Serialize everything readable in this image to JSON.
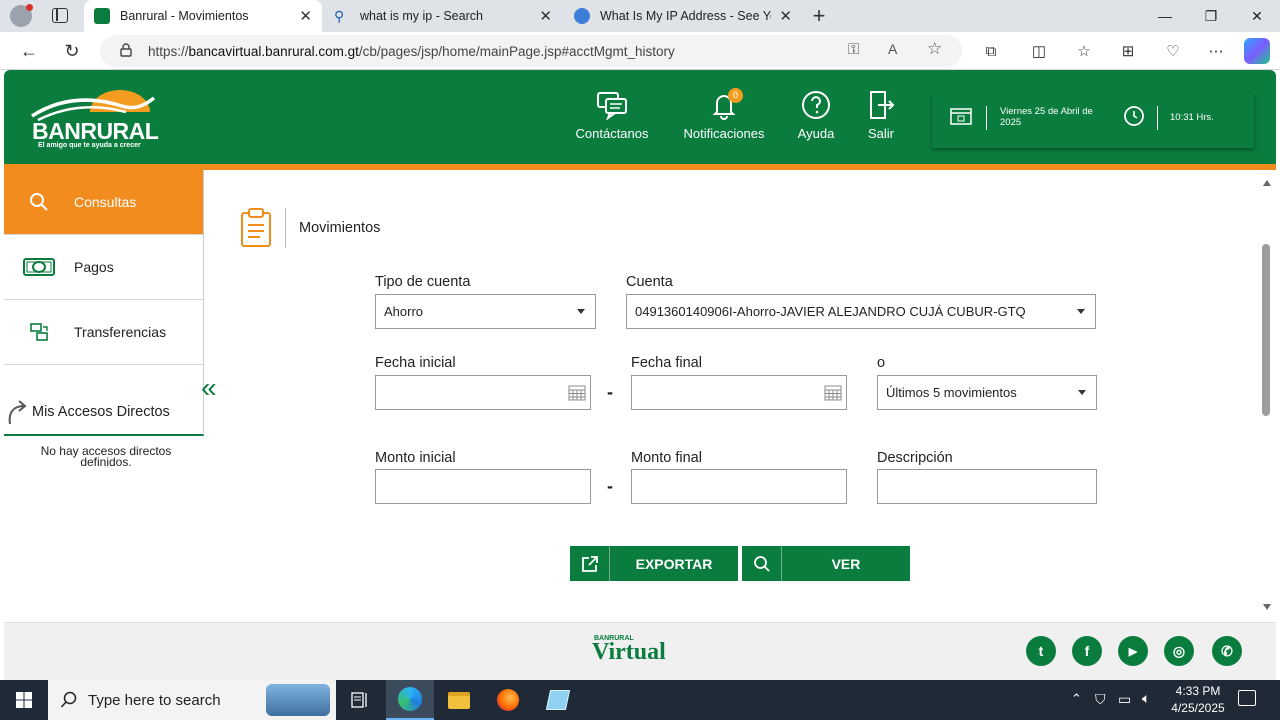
{
  "browser": {
    "tabs": [
      {
        "title": "Banrural - Movimientos"
      },
      {
        "title": "what is my ip - Search"
      },
      {
        "title": "What Is My IP Address - See Your"
      }
    ],
    "url_prefix": "https://",
    "url_host": "bancavirtual.banrural.com.gt",
    "url_path": "/cb/pages/jsp/home/mainPage.jsp#acctMgmt_history"
  },
  "header": {
    "logo_text": "BANRURAL",
    "logo_tagline": "El amigo que te ayuda a crecer",
    "nav": [
      {
        "label": "Contáctanos",
        "icon": "chat-icon"
      },
      {
        "label": "Notificaciones",
        "icon": "bell-icon",
        "badge": "0"
      },
      {
        "label": "Ayuda",
        "icon": "help-icon"
      },
      {
        "label": "Salir",
        "icon": "logout-icon"
      }
    ],
    "date": "Viernes 25 de Abril de 2025",
    "time": "10:31 Hrs."
  },
  "sidebar": {
    "items": [
      {
        "label": "Consultas",
        "icon": "search-icon"
      },
      {
        "label": "Pagos",
        "icon": "money-icon"
      },
      {
        "label": "Transferencias",
        "icon": "transfer-icon"
      }
    ],
    "shortcuts_title": "Mis Accesos Directos",
    "shortcuts_empty": "No hay accesos directos definidos."
  },
  "main": {
    "section_title": "Movimientos",
    "labels": {
      "account_type": "Tipo de cuenta",
      "account": "Cuenta",
      "start_date": "Fecha inicial",
      "end_date": "Fecha final",
      "or": "o",
      "start_amount": "Monto inicial",
      "end_amount": "Monto final",
      "description": "Descripción",
      "dash": "-"
    },
    "values": {
      "account_type": "Ahorro",
      "account": "0491360140906I-Ahorro-JAVIER ALEJANDRO CUJÁ CUBUR-GTQ",
      "period": "Últimos 5 movimientos"
    },
    "buttons": {
      "export": "EXPORTAR",
      "view": "VER"
    }
  },
  "footer": {
    "brand_small": "BANRURAL",
    "brand": "Virtual",
    "social": [
      {
        "icon": "twitter-icon",
        "glyph": "t"
      },
      {
        "icon": "facebook-icon",
        "glyph": "f"
      },
      {
        "icon": "youtube-icon",
        "glyph": "▶"
      },
      {
        "icon": "instagram-icon",
        "glyph": "◎"
      },
      {
        "icon": "whatsapp-icon",
        "glyph": "✆"
      }
    ]
  },
  "taskbar": {
    "search_placeholder": "Type here to search",
    "time": "4:33 PM",
    "date": "4/25/2025"
  },
  "colors": {
    "brand_green": "#0a7d3e",
    "brand_orange": "#f28c1e"
  }
}
